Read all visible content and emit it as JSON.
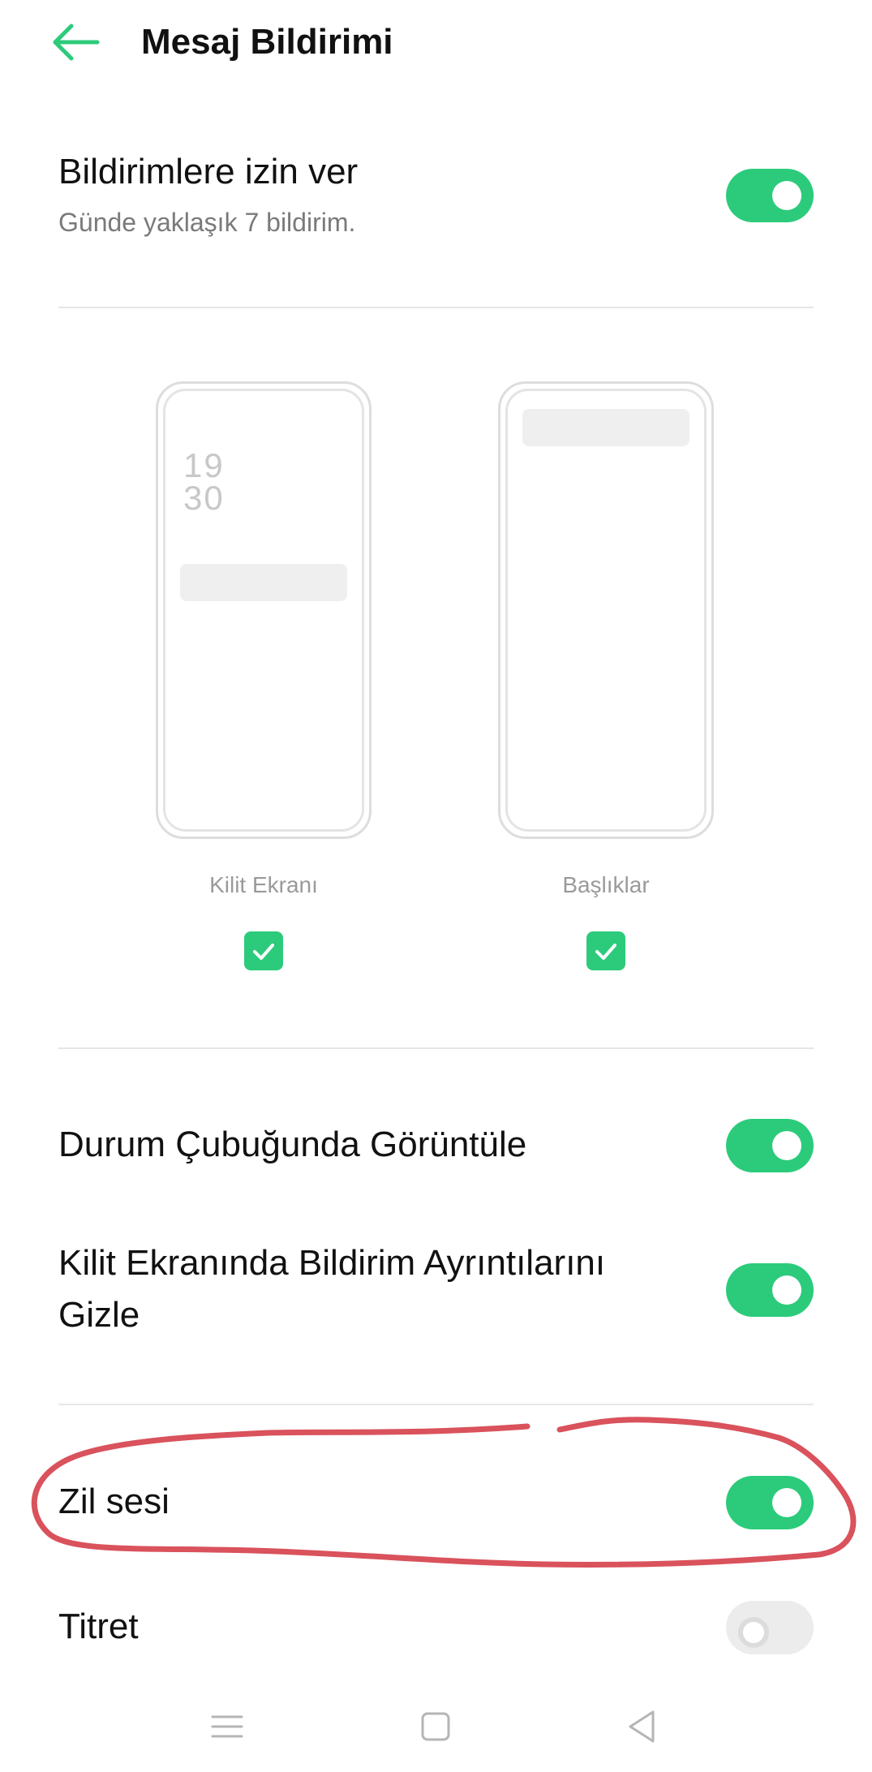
{
  "header": {
    "title": "Mesaj Bildirimi",
    "back_icon": "arrow-left-icon"
  },
  "allow_notifications": {
    "label": "Bildirimlere izin ver",
    "subtitle": "Günde yaklaşık 7 bildirim.",
    "enabled": true
  },
  "previews": [
    {
      "label": "Kilit Ekranı",
      "clock_hour": "19",
      "clock_minute": "30",
      "checked": true
    },
    {
      "label": "Başlıklar",
      "checked": true
    }
  ],
  "settings": [
    {
      "label": "Durum Çubuğunda Görüntüle",
      "enabled": true
    },
    {
      "label_line1": "Kilit Ekranında Bildirim Ayrıntılarını",
      "label_line2": "Gizle",
      "enabled": true
    }
  ],
  "sound": {
    "label": "Zil sesi",
    "enabled": true
  },
  "vibrate": {
    "label": "Titret",
    "enabled": false
  },
  "nav": {
    "icons": [
      "menu-icon",
      "home-icon",
      "back-triangle-icon"
    ]
  },
  "colors": {
    "accent": "#2ccb7b",
    "annotation": "#d9525c"
  }
}
